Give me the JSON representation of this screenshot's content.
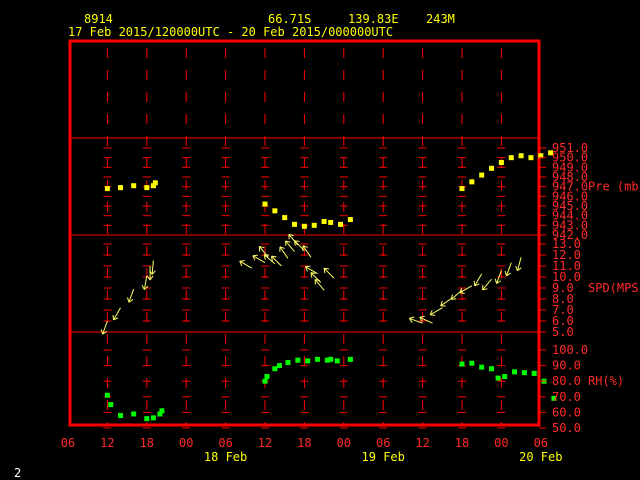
{
  "header": {
    "station": "8914",
    "lat": "66.71S",
    "lon": "139.83E",
    "elev": "243M",
    "period": "17 Feb 2015/120000UTC - 20 Feb 2015/000000UTC"
  },
  "footer": {
    "page": "2"
  },
  "colors": {
    "frame": "#ff0000",
    "grid": "#ff0000",
    "pressure": "#ffff00",
    "wind": "#ffff66",
    "rh": "#00ff00",
    "text_header": "#ffff00",
    "text_axis": "#ff2a2a"
  },
  "chart_data": {
    "type": "scatter",
    "x_axis": {
      "tick_hours": [
        0,
        6,
        12,
        18,
        24,
        30,
        36,
        42,
        48,
        54,
        60,
        66,
        72,
        78,
        84
      ],
      "tick_labels": [
        "06",
        "12",
        "18",
        "00",
        "06",
        "12",
        "18",
        "00",
        "06",
        "12",
        "18",
        "00",
        "06"
      ],
      "day_labels": [
        "18 Feb",
        "19 Feb",
        "20 Feb"
      ]
    },
    "panels": [
      {
        "name": "pressure",
        "label": "Pre (mb)",
        "ylim": [
          942.0,
          951.0
        ],
        "ticks": [
          "942.0",
          "943.0",
          "944.0",
          "945.0",
          "946.0",
          "947.0",
          "948.0",
          "949.0",
          "950.0",
          "951.0"
        ],
        "points": [
          [
            6,
            946.8
          ],
          [
            8,
            946.9
          ],
          [
            10,
            947.1
          ],
          [
            12,
            946.9
          ],
          [
            13,
            947.1
          ],
          [
            13.3,
            947.4
          ],
          [
            30,
            945.2
          ],
          [
            31.5,
            944.5
          ],
          [
            33,
            943.8
          ],
          [
            34.5,
            943.1
          ],
          [
            36,
            942.9
          ],
          [
            37.5,
            943.0
          ],
          [
            39,
            943.4
          ],
          [
            40,
            943.3
          ],
          [
            41.5,
            943.1
          ],
          [
            43,
            943.6
          ],
          [
            60,
            946.8
          ],
          [
            61.5,
            947.5
          ],
          [
            63,
            948.2
          ],
          [
            64.5,
            948.9
          ],
          [
            66,
            949.5
          ],
          [
            67.5,
            950.0
          ],
          [
            69,
            950.2
          ],
          [
            70.5,
            950.0
          ],
          [
            72,
            950.2
          ],
          [
            73.5,
            950.5
          ]
        ]
      },
      {
        "name": "wind",
        "label": "SPD(MPS)",
        "ylim": [
          5.0,
          13.0
        ],
        "ticks": [
          "5.0",
          "6.0",
          "7.0",
          "8.0",
          "9.0",
          "10.0",
          "11.0",
          "12.0",
          "13.0"
        ],
        "barbs": [
          [
            6,
            6.0,
            200
          ],
          [
            8,
            7.2,
            210
          ],
          [
            10,
            8.9,
            200
          ],
          [
            12,
            10.1,
            190
          ],
          [
            12.5,
            11.0,
            180
          ],
          [
            13,
            11.5,
            185
          ],
          [
            28,
            10.8,
            300
          ],
          [
            30,
            11.3,
            300
          ],
          [
            30.5,
            11.8,
            320
          ],
          [
            31.5,
            11.2,
            310
          ],
          [
            32.5,
            11.0,
            315
          ],
          [
            33.5,
            11.7,
            325
          ],
          [
            34.5,
            12.3,
            320
          ],
          [
            35,
            12.9,
            320
          ],
          [
            36,
            12.4,
            315
          ],
          [
            37,
            11.8,
            325
          ],
          [
            38,
            10.3,
            300
          ],
          [
            38.5,
            9.5,
            315
          ],
          [
            39,
            8.8,
            320
          ],
          [
            40.5,
            9.9,
            315
          ],
          [
            54,
            5.8,
            290
          ],
          [
            55.5,
            5.8,
            295
          ],
          [
            57,
            7.2,
            240
          ],
          [
            58.5,
            8.1,
            235
          ],
          [
            60,
            8.8,
            230
          ],
          [
            61.5,
            9.2,
            240
          ],
          [
            63,
            10.3,
            210
          ],
          [
            64.5,
            9.8,
            220
          ],
          [
            66,
            10.6,
            200
          ],
          [
            67.5,
            11.3,
            200
          ],
          [
            69,
            11.8,
            195
          ]
        ]
      },
      {
        "name": "rh",
        "label": "RH(%)",
        "ylim": [
          50.0,
          100.0
        ],
        "ticks": [
          "50.0",
          "60.0",
          "70.0",
          "80.0",
          "90.0",
          "100.0"
        ],
        "points": [
          [
            6,
            71
          ],
          [
            6.5,
            65
          ],
          [
            8,
            58
          ],
          [
            10,
            59
          ],
          [
            12,
            56
          ],
          [
            13,
            56.5
          ],
          [
            14,
            59
          ],
          [
            14.3,
            61
          ],
          [
            30,
            80
          ],
          [
            30.3,
            83
          ],
          [
            31.5,
            88
          ],
          [
            32.2,
            90
          ],
          [
            33.5,
            92
          ],
          [
            35,
            93.5
          ],
          [
            36.5,
            93
          ],
          [
            38,
            94
          ],
          [
            39.5,
            93.5
          ],
          [
            40,
            94
          ],
          [
            41,
            93
          ],
          [
            43,
            94
          ],
          [
            60,
            91
          ],
          [
            61.5,
            91.5
          ],
          [
            63,
            89
          ],
          [
            64.5,
            88
          ],
          [
            65.5,
            82
          ],
          [
            66.5,
            83
          ],
          [
            68,
            86
          ],
          [
            69.5,
            85.5
          ],
          [
            71,
            85
          ],
          [
            72.5,
            80
          ],
          [
            74,
            69
          ]
        ]
      }
    ]
  }
}
